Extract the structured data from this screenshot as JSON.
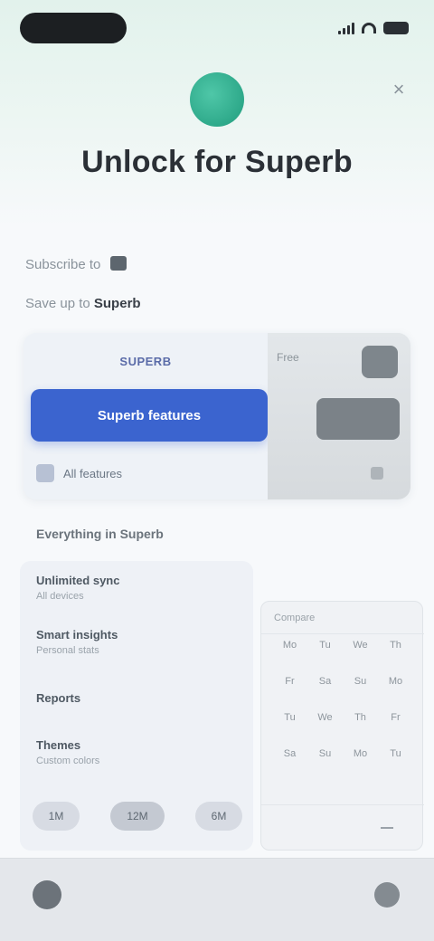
{
  "header": {
    "title": "Unlock for Superb",
    "close_symbol": "×"
  },
  "info": {
    "line1_prefix": "Subscribe to",
    "line2_prefix": "Save up to",
    "line2_value": "Superb"
  },
  "compare": {
    "left_heading": "SUPERB",
    "right_heading": "Free",
    "active_plan": "Superb features",
    "row2_label": "All features"
  },
  "features": {
    "heading": "Everything in Superb",
    "items": [
      {
        "title": "Unlimited sync",
        "subtitle": "All devices"
      },
      {
        "title": "Smart insights",
        "subtitle": "Personal stats"
      },
      {
        "title": "Reports",
        "subtitle": ""
      },
      {
        "title": "Themes",
        "subtitle": "Custom colors"
      }
    ],
    "plans": [
      "1M",
      "12M",
      "6M"
    ]
  },
  "grid": {
    "heading": "Compare",
    "cells": [
      "Mo",
      "Tu",
      "We",
      "Th",
      "Fr",
      "Sa",
      "Su",
      "Mo",
      "Tu",
      "We",
      "Th",
      "Fr",
      "Sa",
      "Su",
      "Mo",
      "Tu"
    ]
  },
  "colors": {
    "accent": "#3b64cf",
    "logo": "#2ea98a"
  }
}
